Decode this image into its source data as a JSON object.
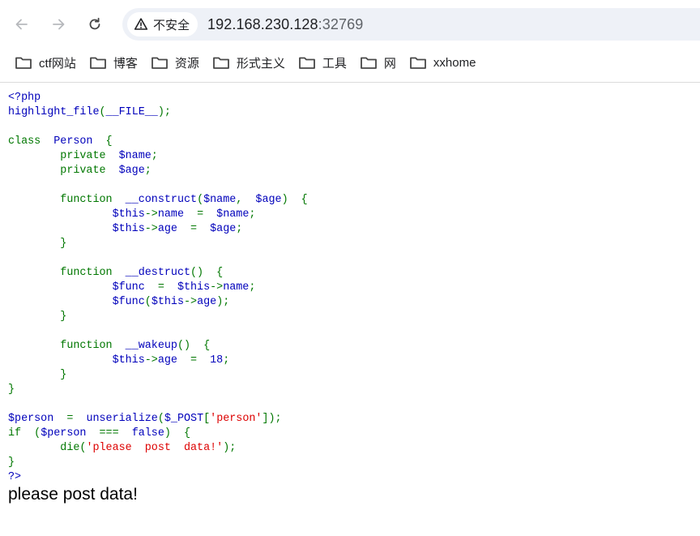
{
  "browser": {
    "security_label": "不安全",
    "url_host": "192.168.230.128",
    "url_port": ":32769",
    "bookmarks": [
      "ctf网站",
      "博客",
      "资源",
      "形式主义",
      "工具",
      "网",
      "xxhome"
    ]
  },
  "code_lines": [
    [
      [
        "<?php",
        "def"
      ]
    ],
    [
      [
        "highlight_file",
        "def"
      ],
      [
        "(",
        "kw"
      ],
      [
        "__FILE__",
        "def"
      ],
      [
        ");",
        "kw"
      ]
    ],
    [],
    [
      [
        "class  ",
        "kw"
      ],
      [
        "Person  ",
        "def"
      ],
      [
        "{",
        "kw"
      ]
    ],
    [
      [
        "        private  ",
        "kw"
      ],
      [
        "$name",
        "def"
      ],
      [
        ";",
        "kw"
      ]
    ],
    [
      [
        "        private  ",
        "kw"
      ],
      [
        "$age",
        "def"
      ],
      [
        ";",
        "kw"
      ]
    ],
    [],
    [
      [
        "        function  ",
        "kw"
      ],
      [
        "__construct",
        "def"
      ],
      [
        "(",
        "kw"
      ],
      [
        "$name",
        "def"
      ],
      [
        ",  ",
        "kw"
      ],
      [
        "$age",
        "def"
      ],
      [
        ")  {",
        "kw"
      ]
    ],
    [
      [
        "                ",
        "kw"
      ],
      [
        "$this",
        "def"
      ],
      [
        "->",
        "kw"
      ],
      [
        "name  ",
        "def"
      ],
      [
        "=  ",
        "kw"
      ],
      [
        "$name",
        "def"
      ],
      [
        ";",
        "kw"
      ]
    ],
    [
      [
        "                ",
        "kw"
      ],
      [
        "$this",
        "def"
      ],
      [
        "->",
        "kw"
      ],
      [
        "age  ",
        "def"
      ],
      [
        "=  ",
        "kw"
      ],
      [
        "$age",
        "def"
      ],
      [
        ";",
        "kw"
      ]
    ],
    [
      [
        "        }",
        "kw"
      ]
    ],
    [],
    [
      [
        "        function  ",
        "kw"
      ],
      [
        "__destruct",
        "def"
      ],
      [
        "()  {",
        "kw"
      ]
    ],
    [
      [
        "                ",
        "kw"
      ],
      [
        "$func  ",
        "def"
      ],
      [
        "=  ",
        "kw"
      ],
      [
        "$this",
        "def"
      ],
      [
        "->",
        "kw"
      ],
      [
        "name",
        "def"
      ],
      [
        ";",
        "kw"
      ]
    ],
    [
      [
        "                ",
        "kw"
      ],
      [
        "$func",
        "def"
      ],
      [
        "(",
        "kw"
      ],
      [
        "$this",
        "def"
      ],
      [
        "->",
        "kw"
      ],
      [
        "age",
        "def"
      ],
      [
        ");",
        "kw"
      ]
    ],
    [
      [
        "        }",
        "kw"
      ]
    ],
    [],
    [
      [
        "        function  ",
        "kw"
      ],
      [
        "__wakeup",
        "def"
      ],
      [
        "()  {",
        "kw"
      ]
    ],
    [
      [
        "                ",
        "kw"
      ],
      [
        "$this",
        "def"
      ],
      [
        "->",
        "kw"
      ],
      [
        "age  ",
        "def"
      ],
      [
        "=  ",
        "kw"
      ],
      [
        "18",
        "def"
      ],
      [
        ";",
        "kw"
      ]
    ],
    [
      [
        "        }",
        "kw"
      ]
    ],
    [
      [
        "}",
        "kw"
      ]
    ],
    [],
    [
      [
        "$person  ",
        "def"
      ],
      [
        "=  ",
        "kw"
      ],
      [
        "unserialize",
        "def"
      ],
      [
        "(",
        "kw"
      ],
      [
        "$_POST",
        "def"
      ],
      [
        "[",
        "kw"
      ],
      [
        "'person'",
        "str"
      ],
      [
        "]);",
        "kw"
      ]
    ],
    [
      [
        "if  (",
        "kw"
      ],
      [
        "$person  ",
        "def"
      ],
      [
        "===  ",
        "kw"
      ],
      [
        "false",
        "def"
      ],
      [
        ")  {",
        "kw"
      ]
    ],
    [
      [
        "        die(",
        "kw"
      ],
      [
        "'please  post  data!'",
        "str"
      ],
      [
        ");",
        "kw"
      ]
    ],
    [
      [
        "}",
        "kw"
      ]
    ],
    [
      [
        "?>",
        "def"
      ]
    ]
  ],
  "output_text": "please post data!"
}
